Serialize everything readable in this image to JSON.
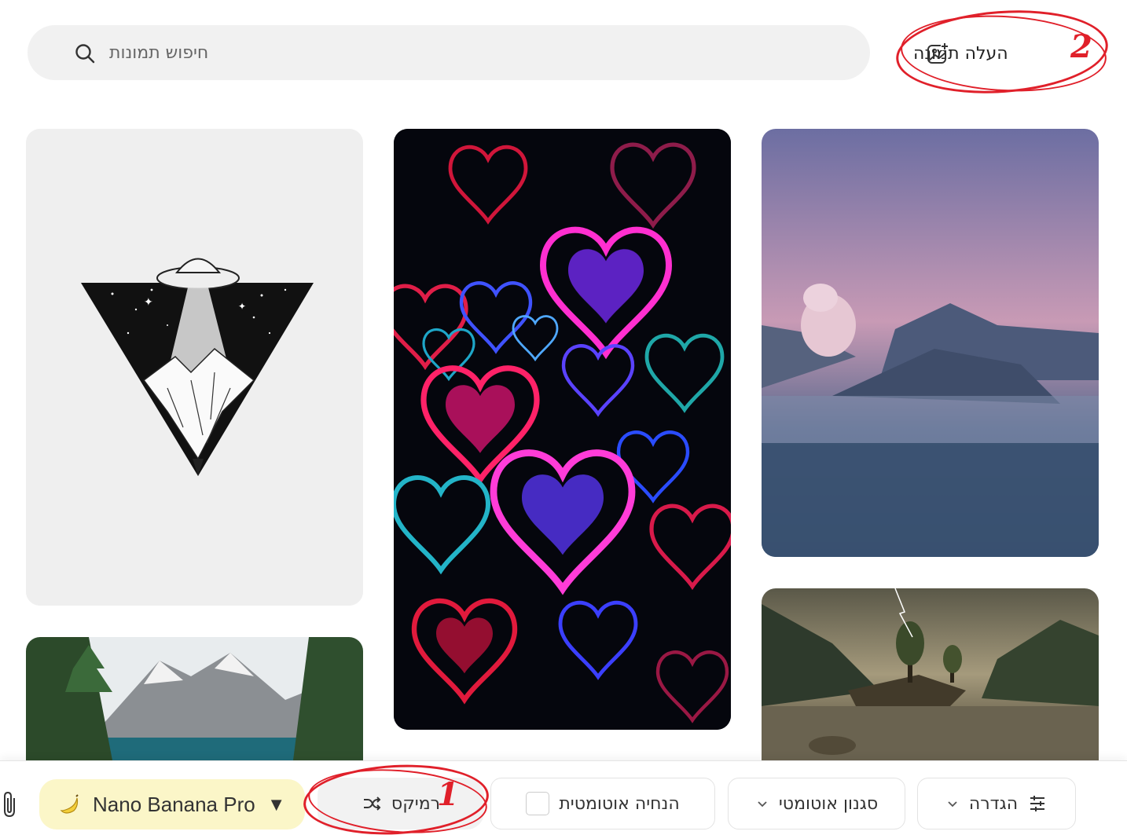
{
  "search": {
    "placeholder": "חיפוש תמונות",
    "icon": "search-icon"
  },
  "upload": {
    "label": "העלה תמונה",
    "icon": "image-upload-icon"
  },
  "annotations": {
    "marker_1": "1",
    "marker_2": "2",
    "color": "#e0202a"
  },
  "gallery": {
    "images": [
      {
        "name": "ufo-triangle-illustration"
      },
      {
        "name": "neon-hearts-wallpaper"
      },
      {
        "name": "misty-volcano-landscape"
      },
      {
        "name": "mountain-lake-with-pines"
      },
      {
        "name": "stormy-lake-island"
      }
    ]
  },
  "toolbar": {
    "attach_icon": "paperclip-icon",
    "model": {
      "label": "Nano Banana Pro",
      "caret": "▼",
      "icon": "banana-icon",
      "bg_color": "#fbf6c8"
    },
    "remix": {
      "label": "רמיקס",
      "icon": "shuffle-icon"
    },
    "auto_hint": {
      "label": "הנחיה אוטומטית"
    },
    "auto_style": {
      "label": "סגנון אוטומטי",
      "icon": "chevron-down-icon"
    },
    "settings": {
      "label": "הגדרה",
      "icon": "sliders-icon"
    }
  }
}
